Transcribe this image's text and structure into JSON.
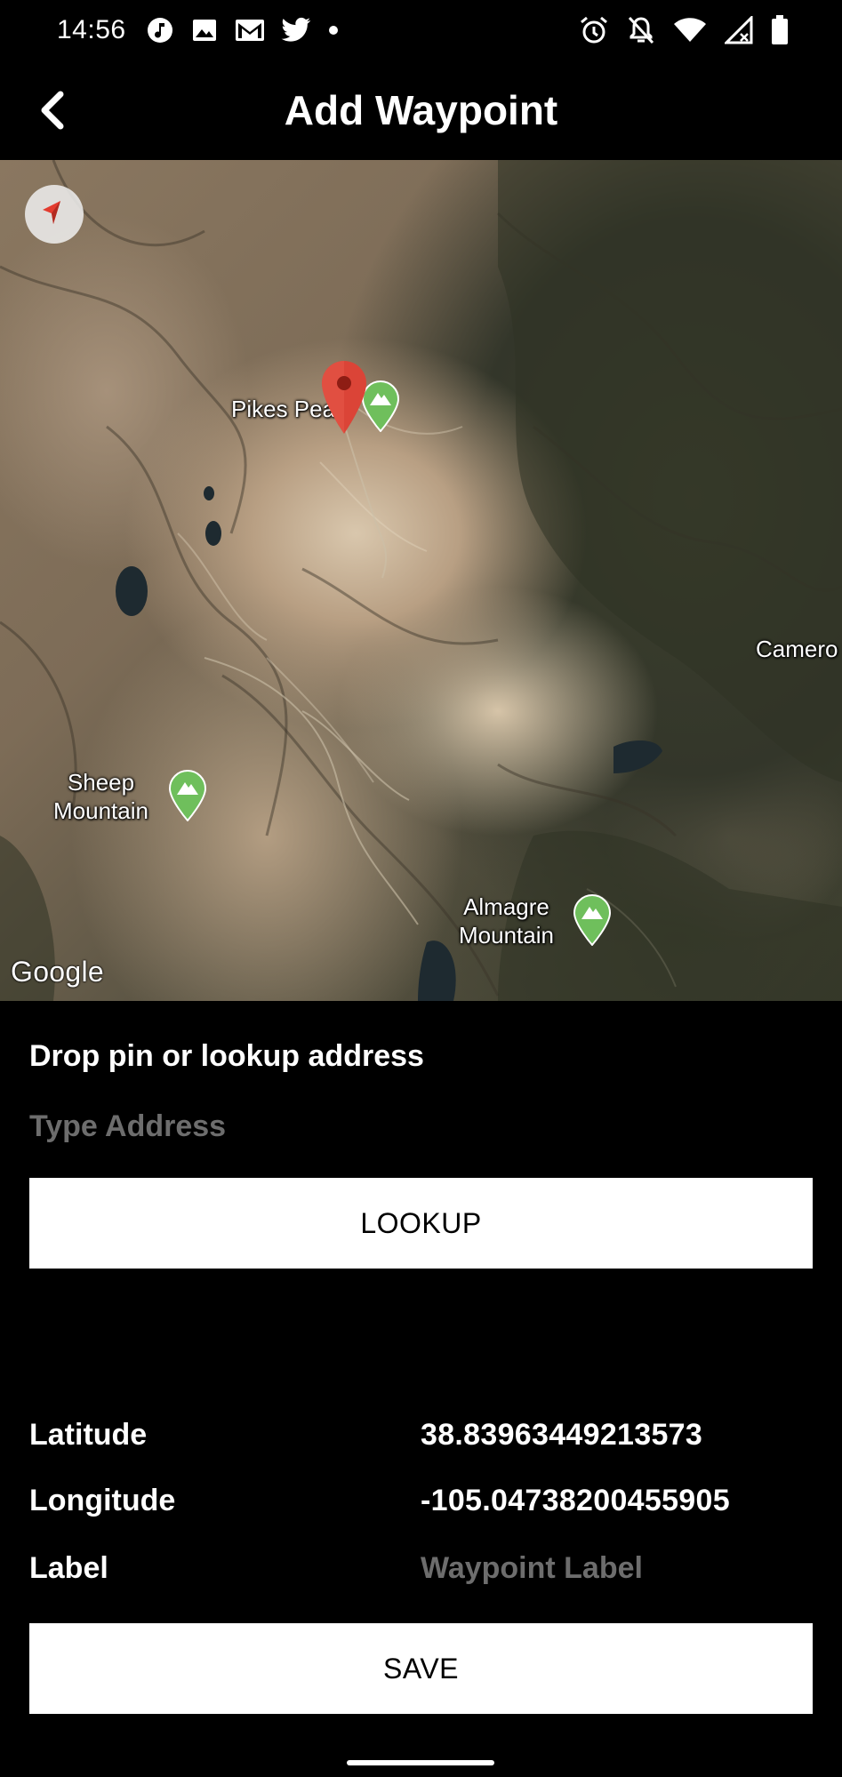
{
  "status_bar": {
    "time": "14:56",
    "left_icons": [
      "music-note-icon",
      "image-icon",
      "gmail-icon",
      "twitter-icon",
      "dot-icon"
    ],
    "right_icons": [
      "alarm-icon",
      "notifications-off-icon",
      "wifi-icon",
      "cellular-no-data-icon",
      "battery-icon"
    ]
  },
  "app_bar": {
    "title": "Add Waypoint",
    "back_icon": "chevron-left-icon"
  },
  "map": {
    "labels": {
      "pikes_peak": "Pikes Peak",
      "sheep_mountain_line1": "Sheep",
      "sheep_mountain_line2": "Mountain",
      "almagre_mountain_line1": "Almagre",
      "almagre_mountain_line2": "Mountain",
      "cameron": "Camero"
    },
    "google_logo": "Google",
    "pin_color": "#DB4437",
    "peak_marker_color": "#6FBF5C"
  },
  "form": {
    "heading": "Drop pin or lookup address",
    "address_placeholder": "Type Address",
    "address_value": "",
    "lookup_label": "LOOKUP",
    "latitude_label": "Latitude",
    "latitude_value": "38.83963449213573",
    "longitude_label": "Longitude",
    "longitude_value": "-105.04738200455905",
    "label_label": "Label",
    "label_placeholder": "Waypoint Label",
    "label_value": "",
    "save_label": "SAVE"
  }
}
